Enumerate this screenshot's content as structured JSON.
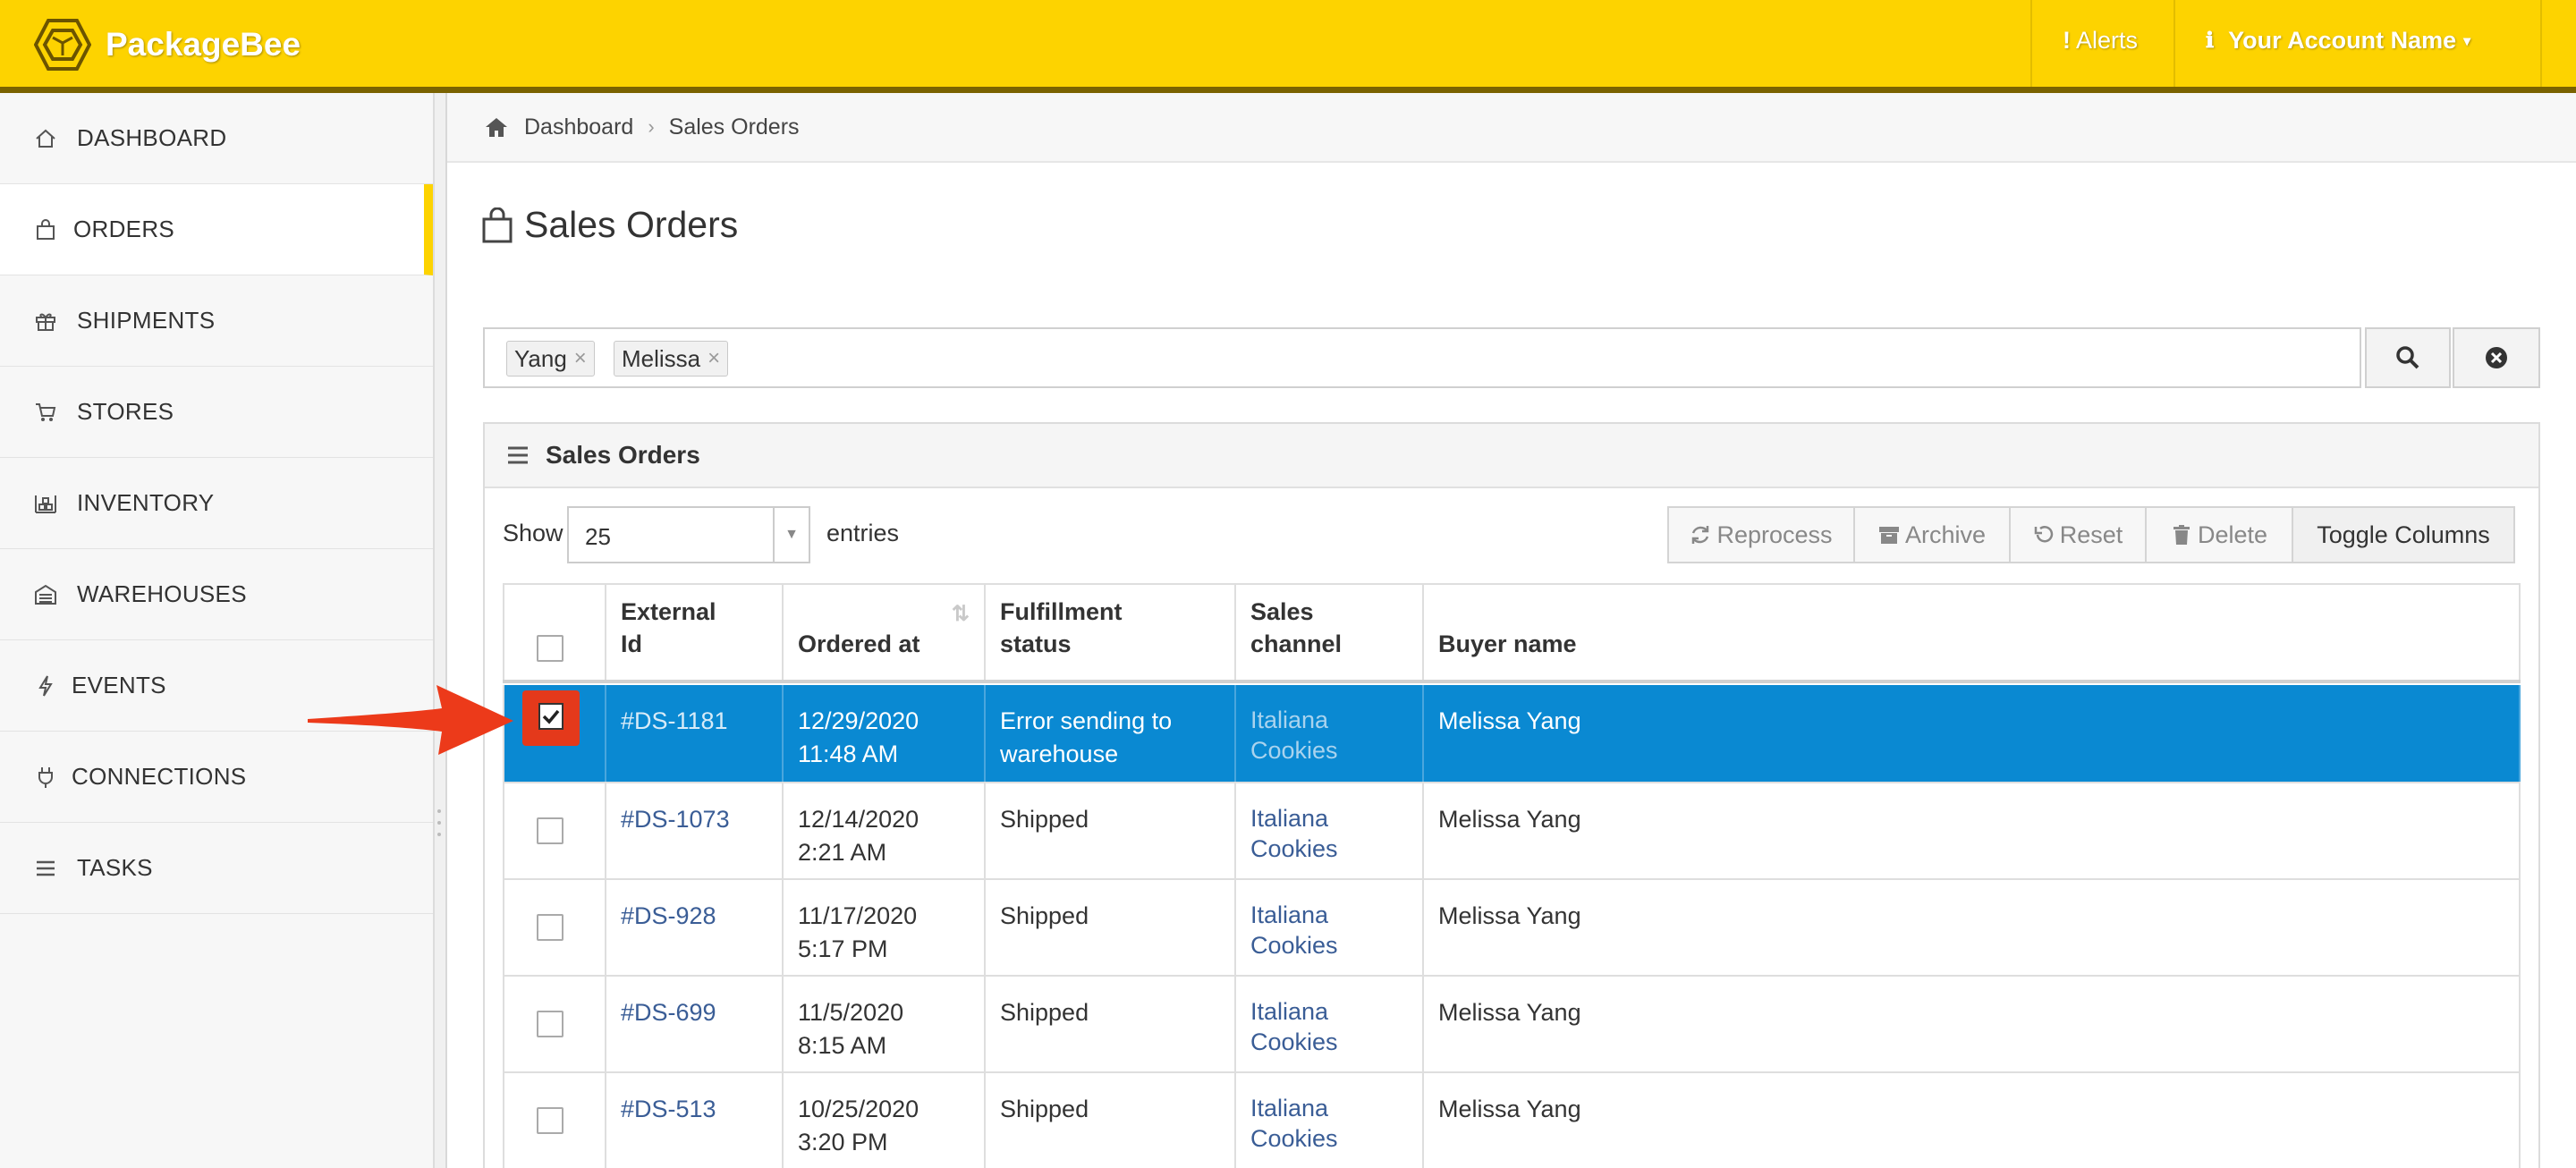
{
  "app": {
    "name": "PackageBee"
  },
  "topbar": {
    "alerts_label": "Alerts",
    "account_label": "Your Account Name"
  },
  "sidebar": {
    "items": [
      {
        "label": "DASHBOARD",
        "icon": "home-icon"
      },
      {
        "label": "ORDERS",
        "icon": "bag-icon",
        "active": true
      },
      {
        "label": "SHIPMENTS",
        "icon": "gift-icon"
      },
      {
        "label": "STORES",
        "icon": "cart-icon"
      },
      {
        "label": "INVENTORY",
        "icon": "inventory-icon"
      },
      {
        "label": "WAREHOUSES",
        "icon": "warehouse-icon"
      },
      {
        "label": "EVENTS",
        "icon": "bolt-icon"
      },
      {
        "label": "CONNECTIONS",
        "icon": "plug-icon"
      },
      {
        "label": "TASKS",
        "icon": "list-icon"
      }
    ]
  },
  "breadcrumb": {
    "home": "Dashboard",
    "current": "Sales Orders"
  },
  "page": {
    "title": "Sales Orders"
  },
  "search": {
    "tags": [
      "Yang",
      "Melissa"
    ]
  },
  "panel": {
    "title": "Sales Orders"
  },
  "entries": {
    "show_label": "Show",
    "value": "25",
    "suffix": "entries"
  },
  "toolbar": {
    "reprocess": "Reprocess",
    "archive": "Archive",
    "reset": "Reset",
    "delete": "Delete",
    "toggle_columns": "Toggle Columns"
  },
  "table": {
    "headers": [
      "External Id",
      "Ordered at",
      "Fulfillment status",
      "Sales channel",
      "Buyer name"
    ],
    "rows": [
      {
        "id": "#DS-1181",
        "date": "12/29/2020",
        "time": "11:48 AM",
        "status": "Error sending to warehouse",
        "channel": "Italiana Cookies",
        "buyer": "Melissa Yang",
        "selected": true
      },
      {
        "id": "#DS-1073",
        "date": "12/14/2020",
        "time": "2:21 AM",
        "status": "Shipped",
        "channel": "Italiana Cookies",
        "buyer": "Melissa Yang",
        "selected": false
      },
      {
        "id": "#DS-928",
        "date": "11/17/2020",
        "time": "5:17 PM",
        "status": "Shipped",
        "channel": "Italiana Cookies",
        "buyer": "Melissa Yang",
        "selected": false
      },
      {
        "id": "#DS-699",
        "date": "11/5/2020",
        "time": "8:15 AM",
        "status": "Shipped",
        "channel": "Italiana Cookies",
        "buyer": "Melissa Yang",
        "selected": false
      },
      {
        "id": "#DS-513",
        "date": "10/25/2020",
        "time": "3:20 PM",
        "status": "Shipped",
        "channel": "Italiana Cookies",
        "buyer": "Melissa Yang",
        "selected": false
      }
    ]
  },
  "colors": {
    "brand": "#fdd300",
    "selected_row": "#0a89d2",
    "annotation": "#e4391b"
  }
}
